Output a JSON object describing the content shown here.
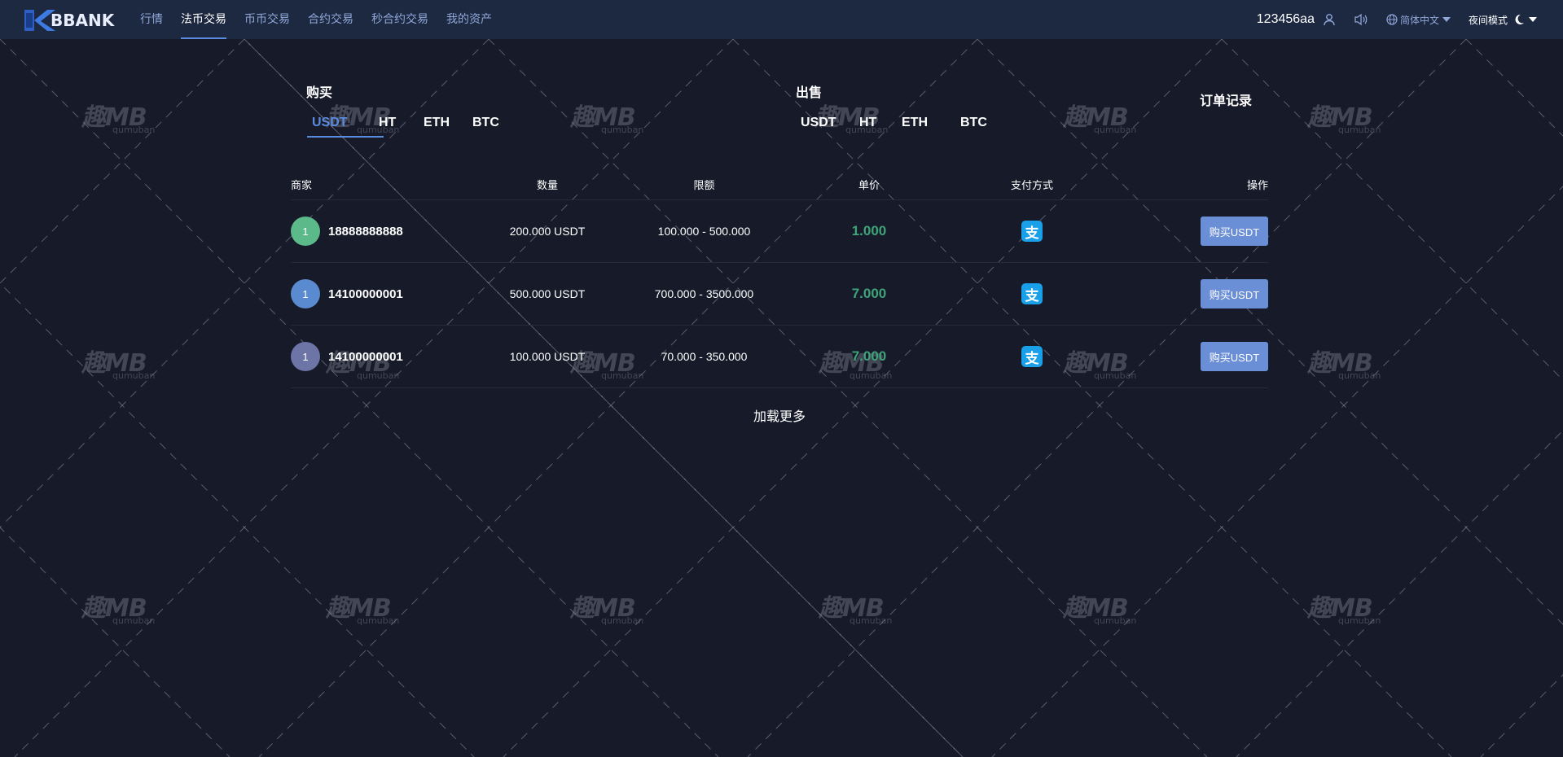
{
  "header": {
    "logo_text": "BBANK",
    "nav": [
      "行情",
      "法币交易",
      "币币交易",
      "合约交易",
      "秒合约交易",
      "我的资产"
    ],
    "active_nav": "法币交易",
    "username": "123456aa",
    "language": "简体中文",
    "night_mode": "夜间模式"
  },
  "buy": {
    "title": "购买",
    "coins": [
      "USDT",
      "HT",
      "ETH",
      "BTC"
    ],
    "active_coin": "USDT"
  },
  "sell": {
    "title": "出售",
    "coins": [
      "USDT",
      "HT",
      "ETH",
      "BTC"
    ]
  },
  "orders_link": "订单记录",
  "table": {
    "columns": [
      "商家",
      "数量",
      "限额",
      "单价",
      "支付方式",
      "操作"
    ],
    "rows": [
      {
        "avatar": "1",
        "avatar_color": "#5bb98a",
        "merchant": "18888888888",
        "quantity": "200.000 USDT",
        "limit": "100.000 - 500.000",
        "price": "1.000",
        "pay_icon": "alipay-icon",
        "action": "购买USDT"
      },
      {
        "avatar": "1",
        "avatar_color": "#5a8bd0",
        "merchant": "14100000001",
        "quantity": "500.000 USDT",
        "limit": "700.000 - 3500.000",
        "price": "7.000",
        "pay_icon": "alipay-icon",
        "action": "购买USDT"
      },
      {
        "avatar": "1",
        "avatar_color": "#6d74a6",
        "merchant": "14100000001",
        "quantity": "100.000 USDT",
        "limit": "70.000 - 350.000",
        "price": "7.000",
        "pay_icon": "alipay-icon",
        "action": "购买USDT"
      }
    ]
  },
  "load_more": "加载更多",
  "watermark": {
    "big": "趣MB",
    "small": "qumuban"
  },
  "colors": {
    "background": "#171b29",
    "header": "#1d2841",
    "accent": "#5b8be0",
    "price_green": "#3fa37a",
    "button": "#6b8fd6",
    "alipay": "#1aa0e8"
  }
}
